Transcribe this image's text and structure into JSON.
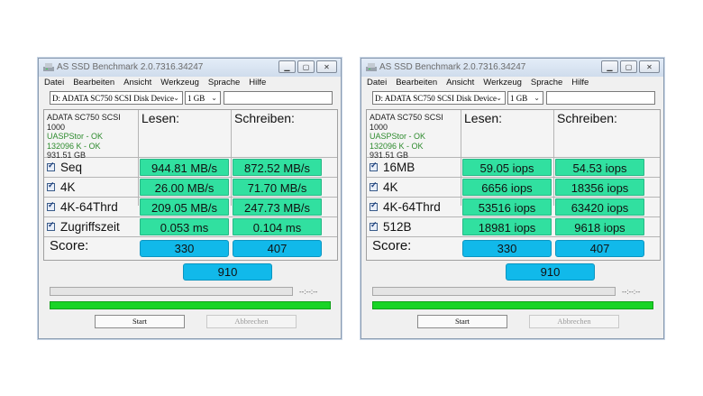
{
  "windows": [
    {
      "title": "AS SSD Benchmark 2.0.7316.34247",
      "menu": [
        "Datei",
        "Bearbeiten",
        "Ansicht",
        "Werkzeug",
        "Sprache",
        "Hilfe"
      ],
      "drive": "D: ADATA SC750 SCSI Disk Device",
      "size": "1 GB",
      "info": {
        "model": "ADATA SC750 SCSI",
        "fw": "1000",
        "driver": "UASPStor - OK",
        "align": "132096 K - OK",
        "capacity": "931.51 GB"
      },
      "header_read": "Lesen:",
      "header_write": "Schreiben:",
      "rows": [
        {
          "label": "Seq",
          "read": "944.81 MB/s",
          "write": "872.52 MB/s"
        },
        {
          "label": "4K",
          "read": "26.00 MB/s",
          "write": "71.70 MB/s"
        },
        {
          "label": "4K-64Thrd",
          "read": "209.05 MB/s",
          "write": "247.73 MB/s"
        },
        {
          "label": "Zugriffszeit",
          "read": "0.053 ms",
          "write": "0.104 ms"
        }
      ],
      "score_label": "Score:",
      "score_read": "330",
      "score_write": "407",
      "score_total": "910",
      "timer": "--:--:--",
      "start_label": "Start",
      "abort_label": "Abbrechen"
    },
    {
      "title": "AS SSD Benchmark 2.0.7316.34247",
      "menu": [
        "Datei",
        "Bearbeiten",
        "Ansicht",
        "Werkzeug",
        "Sprache",
        "Hilfe"
      ],
      "drive": "D: ADATA SC750 SCSI Disk Device",
      "size": "1 GB",
      "info": {
        "model": "ADATA SC750 SCSI",
        "fw": "1000",
        "driver": "UASPStor - OK",
        "align": "132096 K - OK",
        "capacity": "931.51 GB"
      },
      "header_read": "Lesen:",
      "header_write": "Schreiben:",
      "rows": [
        {
          "label": "16MB",
          "read": "59.05 iops",
          "write": "54.53 iops"
        },
        {
          "label": "4K",
          "read": "6656 iops",
          "write": "18356 iops"
        },
        {
          "label": "4K-64Thrd",
          "read": "53516 iops",
          "write": "63420 iops"
        },
        {
          "label": "512B",
          "read": "18981 iops",
          "write": "9618 iops"
        }
      ],
      "score_label": "Score:",
      "score_read": "330",
      "score_write": "407",
      "score_total": "910",
      "timer": "--:--:--",
      "start_label": "Start",
      "abort_label": "Abbrechen"
    }
  ]
}
